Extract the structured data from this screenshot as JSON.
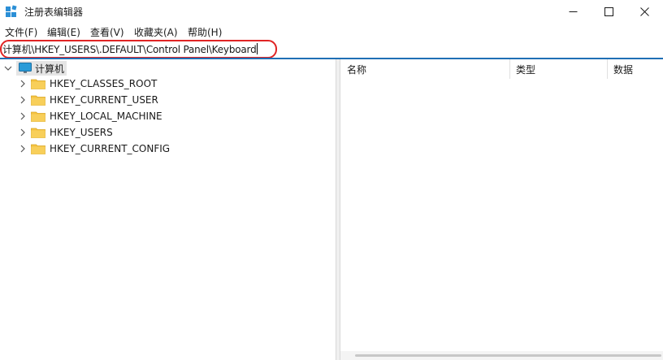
{
  "window": {
    "title": "注册表编辑器",
    "icon": "registry-editor-icon",
    "accent_color": "#1f6fb5"
  },
  "menu": [
    {
      "label": "文件(F)"
    },
    {
      "label": "编辑(E)"
    },
    {
      "label": "查看(V)"
    },
    {
      "label": "收藏夹(A)"
    },
    {
      "label": "帮助(H)"
    }
  ],
  "address": {
    "value": "计算机\\HKEY_USERS\\.DEFAULT\\Control Panel\\Keyboard",
    "highlight_color": "#e02424"
  },
  "tree": {
    "root": {
      "label": "计算机",
      "icon": "computer-icon",
      "expanded": true
    },
    "children": [
      {
        "label": "HKEY_CLASSES_ROOT",
        "icon": "folder-icon"
      },
      {
        "label": "HKEY_CURRENT_USER",
        "icon": "folder-icon"
      },
      {
        "label": "HKEY_LOCAL_MACHINE",
        "icon": "folder-icon"
      },
      {
        "label": "HKEY_USERS",
        "icon": "folder-icon"
      },
      {
        "label": "HKEY_CURRENT_CONFIG",
        "icon": "folder-icon"
      }
    ]
  },
  "list": {
    "columns": [
      {
        "label": "名称"
      },
      {
        "label": "类型"
      },
      {
        "label": "数据"
      }
    ]
  }
}
